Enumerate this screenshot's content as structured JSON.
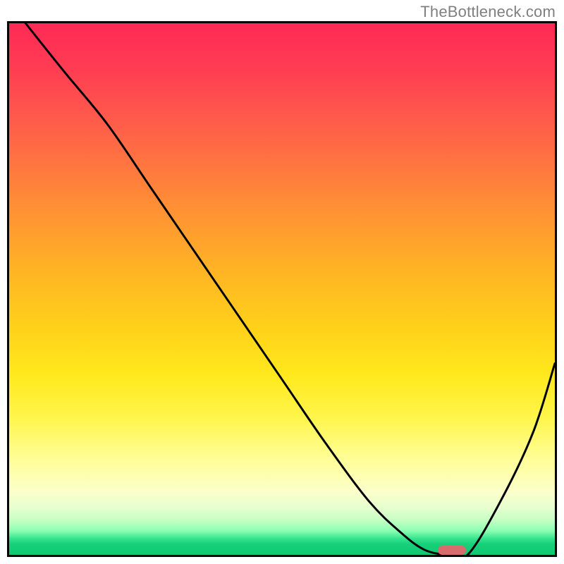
{
  "watermark": "TheBottleneck.com",
  "colors": {
    "border": "#000000",
    "curve": "#000000",
    "marker": "#d86b6c",
    "watermark": "#808080"
  },
  "chart_data": {
    "type": "line",
    "title": "",
    "xlabel": "",
    "ylabel": "",
    "xlim": [
      0,
      100
    ],
    "ylim": [
      0,
      100
    ],
    "grid": false,
    "legend": false,
    "series": [
      {
        "name": "bottleneck-curve",
        "x": [
          3,
          10,
          18,
          26,
          34,
          42,
          50,
          58,
          66,
          72,
          76,
          80,
          84,
          90,
          96,
          100
        ],
        "y": [
          100,
          91,
          81,
          69,
          57,
          45,
          33,
          21,
          10,
          4,
          1,
          0,
          0,
          10,
          23,
          36
        ]
      }
    ],
    "marker": {
      "x_center_pct": 80.5,
      "y_pct": 0,
      "width_pct": 5.2,
      "height_pct": 1.7
    }
  }
}
